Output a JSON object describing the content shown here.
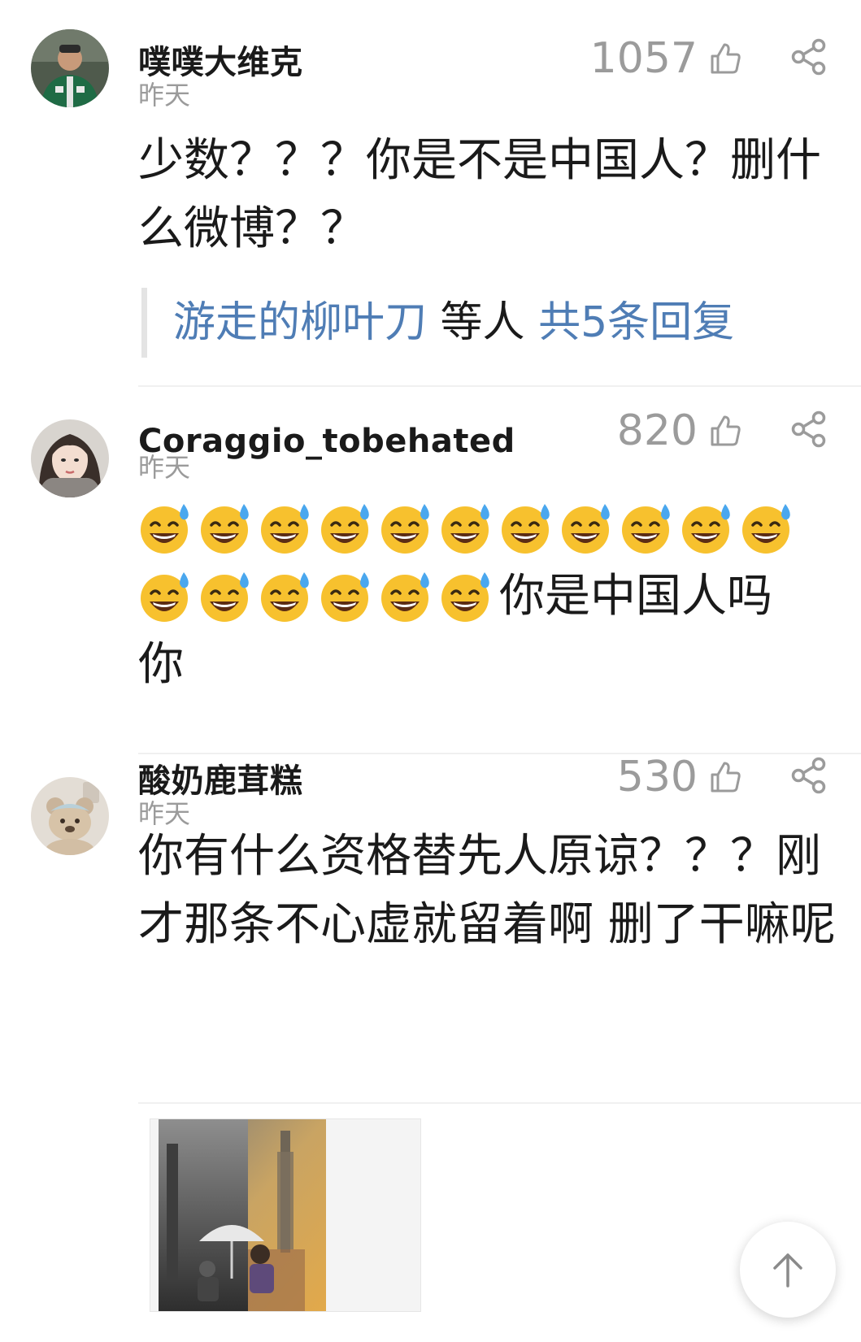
{
  "comments": [
    {
      "username": "噗噗大维克",
      "time": "昨天",
      "likes": "1057",
      "text": "少数？？？你是不是中国人？删什么微博？？",
      "replies": {
        "users": "游走的柳叶刀",
        "middle": " 等人 ",
        "count": "共5条回复"
      }
    },
    {
      "username": "Coraggio_tobehated",
      "time": "昨天",
      "likes": "820",
      "emoji_icon": "sweat-smile-emoji",
      "emoji_count": 17,
      "text_after_emoji": "你是中国人吗你"
    },
    {
      "username": "酸奶鹿茸糕",
      "time": "昨天",
      "likes": "530",
      "text": "你有什么资格替先人原谅？？？刚才那条不心虚就留着啊 删了干嘛呢"
    }
  ],
  "icons": {
    "like": "thumbs-up-icon",
    "share": "share-icon",
    "scroll_top": "arrow-up-icon"
  },
  "colors": {
    "link": "#4f7db5",
    "muted": "#9b9b9b",
    "emoji_face": "#f7c12e",
    "sweat_drop": "#4aa7ee"
  }
}
